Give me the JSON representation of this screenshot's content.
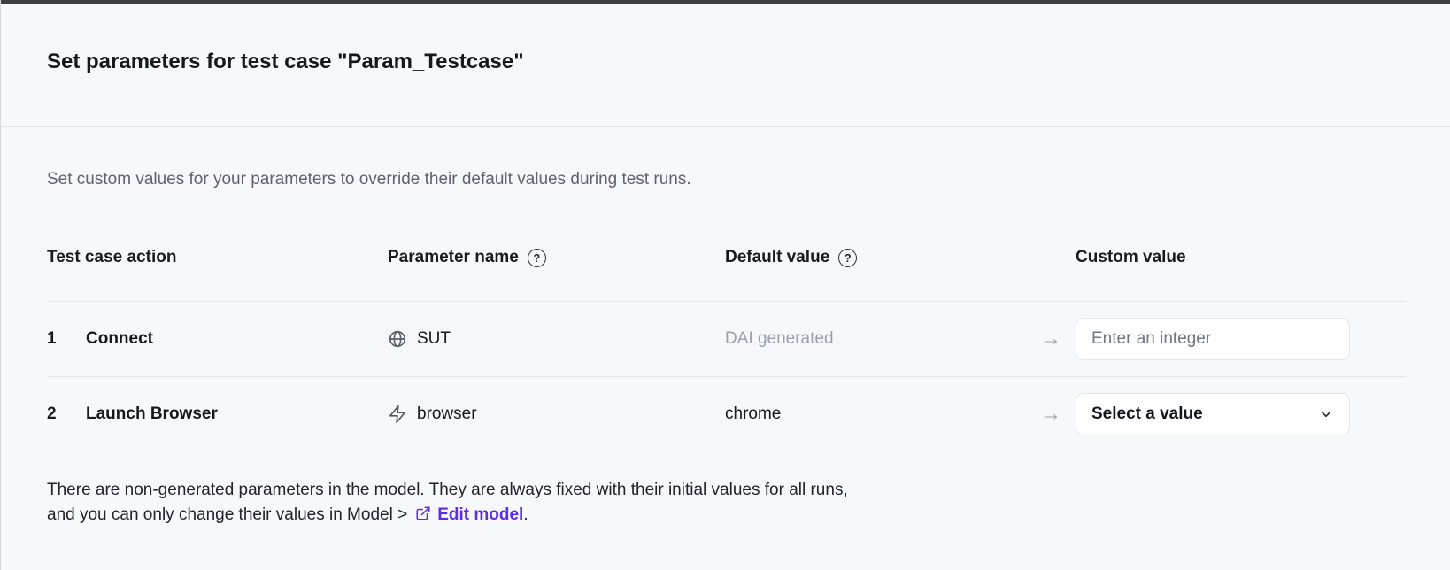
{
  "colors": {
    "accent_purple": "#5c2ede",
    "topbar": "#3e4144",
    "background": "#f7f8fb"
  },
  "header": {
    "title": "Set parameters for test case \"Param_Testcase\""
  },
  "intro": {
    "text": "Set custom values for your parameters to override their default values during test runs."
  },
  "table": {
    "headers": {
      "action": "Test case action",
      "param": "Parameter name",
      "default": "Default value",
      "custom": "Custom value"
    },
    "help_glyph": "?",
    "arrow_glyph": "→",
    "rows": [
      {
        "num": "1",
        "action": "Connect",
        "param_icon": "globe-icon",
        "param": "SUT",
        "default": "DAI generated",
        "input_placeholder": "Enter an integer"
      },
      {
        "num": "2",
        "action": "Launch Browser",
        "param_icon": "zap-icon",
        "param": "browser",
        "default": "chrome",
        "select_value": "Select a value"
      }
    ]
  },
  "footer": {
    "line1": "There are non-generated parameters in the model. They are always fixed with their initial values for all runs,",
    "line2_prefix": "and you can only change their values in Model >",
    "link_label": "Edit model",
    "line2_suffix": "."
  }
}
